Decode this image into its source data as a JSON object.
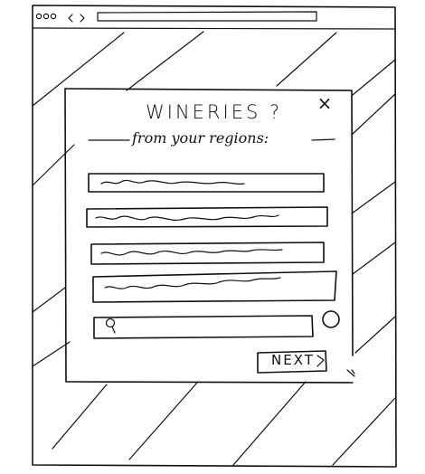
{
  "browser": {
    "window_dots": [
      "dot",
      "dot",
      "dot"
    ],
    "back_icon": "chevron-left-icon",
    "forward_icon": "chevron-right-icon",
    "address_bar_value": ""
  },
  "modal": {
    "title": "WINERIES ?",
    "subtitle": "from your regions:",
    "close_icon": "close-icon",
    "list_items": [
      {
        "placeholder_icon": "squiggle-placeholder-text"
      },
      {
        "placeholder_icon": "squiggle-placeholder-text"
      },
      {
        "placeholder_icon": "squiggle-placeholder-text"
      },
      {
        "placeholder_icon": "squiggle-placeholder-text"
      }
    ],
    "search": {
      "icon": "search-icon",
      "value": "",
      "round_button_icon": "circle-icon"
    },
    "next_label": "NEXT",
    "next_icon": "chevron-right-icon",
    "corner_icon": "resize-handle-icon"
  },
  "background": {
    "pattern": "diagonal-hatch"
  }
}
